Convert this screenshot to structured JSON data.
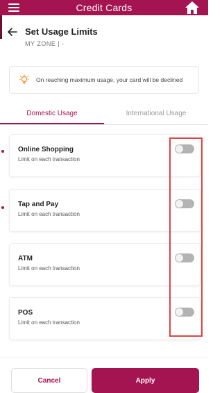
{
  "appbar": {
    "title": "Credit Cards",
    "menu_icon": "hamburger-menu-icon",
    "home_icon": "home-icon"
  },
  "header": {
    "title": "Set Usage Limits",
    "subtitle": "MY ZONE | -"
  },
  "notice": {
    "text": "On reaching maximum usage, your card will be declined",
    "icon": "bulb-icon"
  },
  "tabs": [
    {
      "label": "Domestic Usage",
      "active": true
    },
    {
      "label": "International Usage",
      "active": false
    }
  ],
  "limits": [
    {
      "title": "Online Shopping",
      "subtitle": "Limit on each transaction",
      "enabled": false
    },
    {
      "title": "Tap and Pay",
      "subtitle": "Limit on each transaction",
      "enabled": false
    },
    {
      "title": "ATM",
      "subtitle": "Limit on each transaction",
      "enabled": false
    },
    {
      "title": "POS",
      "subtitle": "Limit on each transaction",
      "enabled": false
    }
  ],
  "footer": {
    "cancel_label": "Cancel",
    "apply_label": "Apply"
  },
  "colors": {
    "brand": "#a31451",
    "highlight": "#e2433f",
    "toggle_off": "#b3b3b3"
  }
}
